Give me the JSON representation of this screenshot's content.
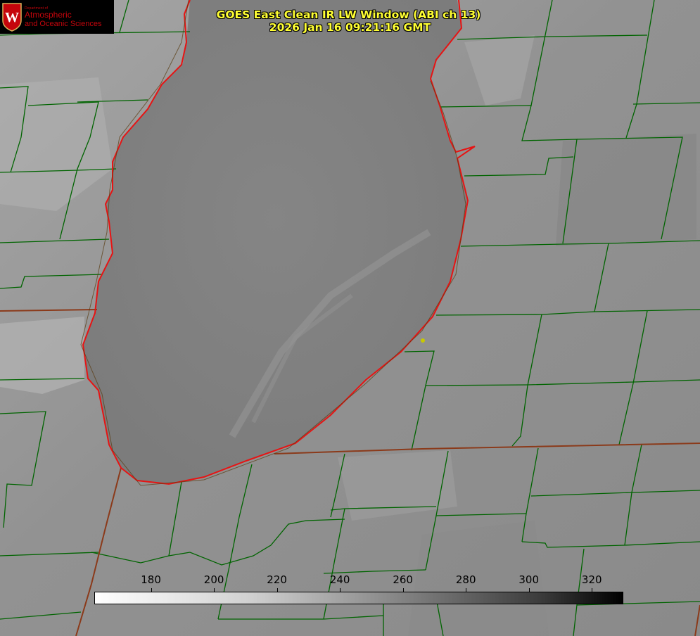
{
  "logo": {
    "department": "Department of",
    "line1": "Atmospheric",
    "line2": "and Oceanic Sciences",
    "seal_letter": "W",
    "color": "#c5050c"
  },
  "title": {
    "line1": "GOES East Clean IR LW Window (ABI ch 13)",
    "line2": "2026 Jan 16 09:21:16 GMT",
    "color": "#ffff33"
  },
  "colorbar": {
    "ticks": [
      "180",
      "200",
      "220",
      "240",
      "260",
      "280",
      "300",
      "320"
    ],
    "vmin": 162,
    "vmax": 330,
    "from_color": "#ffffff",
    "to_color": "#000000"
  },
  "map_styles": {
    "county_line_color": "#006400",
    "state_line_color": "#8b3a1a",
    "lake_outline_color": "#e61414",
    "station_dot_color": "#c8c800"
  }
}
